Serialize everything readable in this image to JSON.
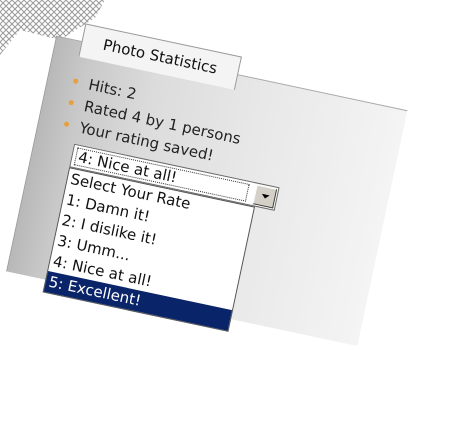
{
  "widget": {
    "title": "Photo Statistics",
    "stats": [
      "Hits: 2",
      "Rated 4 by 1 persons",
      "Your rating saved!"
    ],
    "rating_select": {
      "selected_value": "4: Nice at all!",
      "options": [
        "Select Your Rate",
        "1: Damn it!",
        "2: I dislike it!",
        "3: Umm...",
        "4: Nice at all!",
        "5: Excellent!"
      ],
      "highlighted_option": "5: Excellent!"
    }
  },
  "colors": {
    "bullet": "#e8a03c",
    "highlight": "#0a246a",
    "highlight_text": "#ffffff"
  }
}
